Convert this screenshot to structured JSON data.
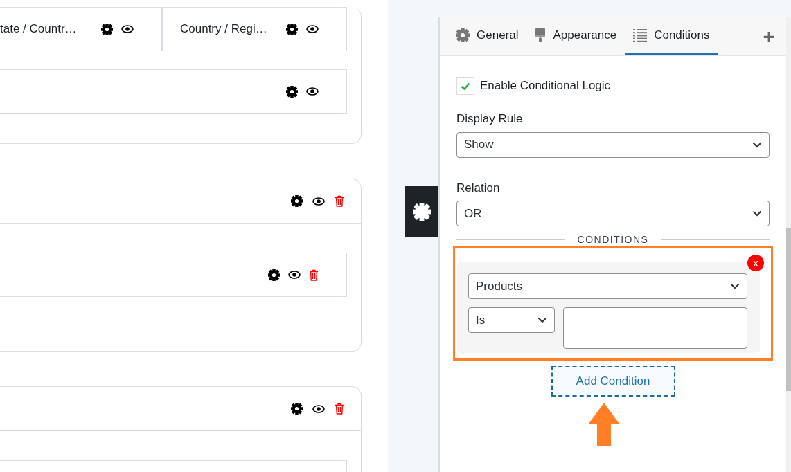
{
  "cards": [
    {
      "fields": [
        {
          "cells": [
            "tate / Countr…",
            "Country / Regi…"
          ],
          "deletable": false
        },
        {
          "deletable": false
        }
      ]
    },
    {
      "header": {
        "deletable": true
      },
      "fields": [
        {
          "deletable": true
        }
      ]
    },
    {
      "header": {
        "deletable": true
      }
    }
  ],
  "panel": {
    "tabs": [
      {
        "label": "General",
        "selected": false
      },
      {
        "label": "Appearance",
        "selected": false
      },
      {
        "label": "Conditions",
        "selected": true
      }
    ],
    "add_tab": "+",
    "enable_logic": {
      "label": "Enable Conditional Logic",
      "checked": true
    },
    "display_rule": {
      "label": "Display Rule",
      "value": "Show"
    },
    "relation": {
      "label": "Relation",
      "value": "OR"
    },
    "section_title": "CONDITIONS",
    "conditions": [
      {
        "field": "Products",
        "operator": "Is",
        "highlighted": true,
        "remove": "x"
      }
    ],
    "add_button": "Add Condition"
  }
}
